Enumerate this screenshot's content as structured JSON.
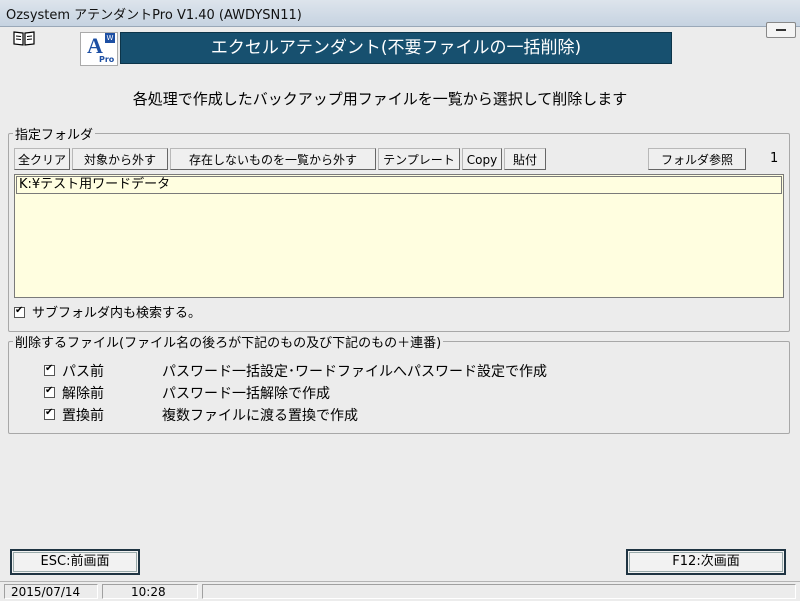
{
  "window": {
    "title": "Ozsystem アテンダントPro V1.40 (AWDYSN11)"
  },
  "logo": {
    "letter": "A",
    "badge": "W",
    "sub": "Pro"
  },
  "banner": {
    "title": "エクセルアテンダント(不要ファイルの一括削除)"
  },
  "description": "各処理で作成したバックアップ用ファイルを一覧から選択して削除します",
  "folder_group": {
    "legend": "指定フォルダ",
    "toolbar": {
      "clear_all": "全クリア",
      "exclude": "対象から外す",
      "exclude_missing": "存在しないものを一覧から外す",
      "template": "テンプレート",
      "copy": "Copy",
      "paste": "貼付",
      "browse": "フォルダ参照"
    },
    "count": "1",
    "folders": [
      "K:¥テスト用ワードデータ"
    ],
    "subfolder_label": "サブフォルダ内も検索する。",
    "subfolder_checked": true
  },
  "delete_group": {
    "legend": "削除するファイル(ファイル名の後ろが下記のもの及び下記のもの＋連番)",
    "items": [
      {
        "name": "パス前",
        "desc": "パスワード一括設定･ワードファイルへパスワード設定で作成",
        "checked": true
      },
      {
        "name": "解除前",
        "desc": "パスワード一括解除で作成",
        "checked": true
      },
      {
        "name": "置換前",
        "desc": "複数ファイルに渡る置換で作成",
        "checked": true
      }
    ]
  },
  "footer": {
    "esc_label": "ESC:前画面",
    "f12_label": "F12:次画面"
  },
  "status": {
    "date": "2015/07/14",
    "time": "10:28"
  },
  "colors": {
    "banner_bg": "#17506f",
    "list_bg": "#fffee0",
    "logo_blue": "#1d4fa3"
  }
}
